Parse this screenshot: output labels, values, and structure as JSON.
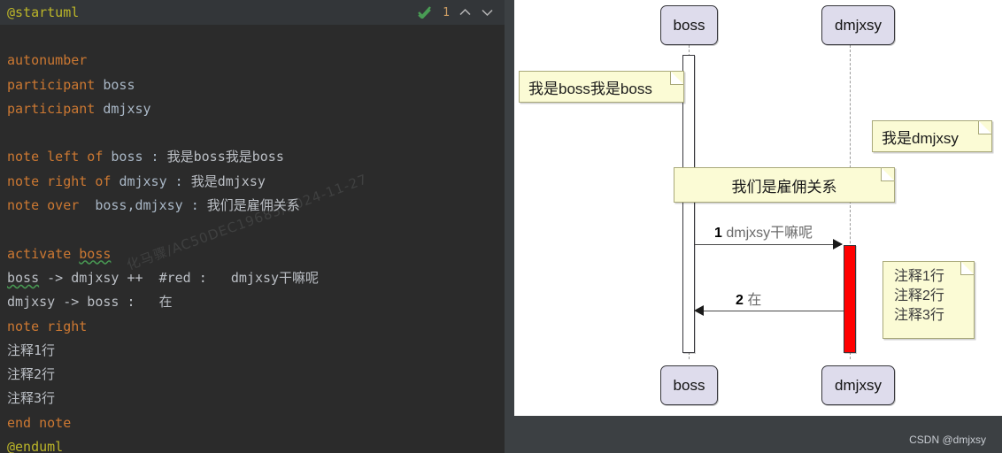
{
  "editor": {
    "first_line": "@startuml",
    "inspection_count": "1",
    "icons": {
      "check": "check-mark-icon",
      "up": "chevron-up-icon",
      "down": "chevron-down-icon"
    },
    "watermark": "化马骤/AC50DEC19685/2024-11-27",
    "lines": [
      {
        "indent": 0,
        "parts": []
      },
      {
        "parts": [
          {
            "t": "autonumber",
            "c": "kw"
          }
        ]
      },
      {
        "parts": [
          {
            "t": "participant ",
            "c": "kw"
          },
          {
            "t": "boss",
            "c": "id"
          }
        ]
      },
      {
        "parts": [
          {
            "t": "participant ",
            "c": "kw"
          },
          {
            "t": "dmjxsy",
            "c": "id"
          }
        ]
      },
      {
        "parts": []
      },
      {
        "parts": [
          {
            "t": "note left of ",
            "c": "kw"
          },
          {
            "t": "boss",
            "c": "id"
          },
          {
            "t": " : ",
            "c": "id"
          },
          {
            "t": "我是boss我是boss",
            "c": "plain"
          }
        ]
      },
      {
        "parts": [
          {
            "t": "note right of ",
            "c": "kw"
          },
          {
            "t": "dmjxsy",
            "c": "id"
          },
          {
            "t": " : ",
            "c": "id"
          },
          {
            "t": "我是dmjxsy",
            "c": "plain"
          }
        ]
      },
      {
        "parts": [
          {
            "t": "note over ",
            "c": "kw"
          },
          {
            "t": " boss,dmjxsy",
            "c": "id"
          },
          {
            "t": " : ",
            "c": "id"
          },
          {
            "t": "我们是雇佣关系",
            "c": "plain"
          }
        ]
      },
      {
        "parts": []
      },
      {
        "parts": [
          {
            "t": "activate ",
            "c": "kw"
          },
          {
            "t": "boss",
            "c": "kw err"
          }
        ]
      },
      {
        "parts": [
          {
            "t": "boss",
            "c": "plain err"
          },
          {
            "t": " -> dmjxsy ++  #red :   dmjxsy干嘛呢",
            "c": "plain"
          }
        ]
      },
      {
        "parts": [
          {
            "t": "dmjxsy -> boss :   在",
            "c": "plain"
          }
        ]
      },
      {
        "parts": [
          {
            "t": "note right",
            "c": "kw"
          }
        ]
      },
      {
        "parts": [
          {
            "t": "注释1行",
            "c": "plain"
          }
        ]
      },
      {
        "parts": [
          {
            "t": "注释2行",
            "c": "plain"
          }
        ]
      },
      {
        "parts": [
          {
            "t": "注释3行",
            "c": "plain"
          }
        ]
      },
      {
        "parts": [
          {
            "t": "end note",
            "c": "kw"
          }
        ]
      },
      {
        "parts": [
          {
            "t": "@enduml",
            "c": "anno"
          }
        ]
      }
    ]
  },
  "diagram": {
    "watermark": "CSDN @dmjxsy",
    "participants": [
      {
        "name": "boss",
        "pos": "top"
      },
      {
        "name": "dmjxsy",
        "pos": "top"
      },
      {
        "name": "boss",
        "pos": "bottom"
      },
      {
        "name": "dmjxsy",
        "pos": "bottom"
      }
    ],
    "notes": [
      {
        "id": "note-left-boss",
        "text": "我是boss我是boss"
      },
      {
        "id": "note-right-dmjxsy",
        "text": "我是dmjxsy"
      },
      {
        "id": "note-over-both",
        "text": "我们是雇佣关系"
      }
    ],
    "note_multiline": {
      "id": "note-right-dmjxsy-multiline",
      "lines": [
        "注释1行",
        "注释2行",
        "注释3行"
      ]
    },
    "messages": [
      {
        "number": "1",
        "text": "dmjxsy干嘛呢",
        "direction": "right"
      },
      {
        "number": "2",
        "text": "在",
        "direction": "left"
      }
    ],
    "colors": {
      "participant_fill": "#dedcec",
      "note_fill": "#fbfbd5",
      "activation_red": "#ff0000",
      "activation_white": "#ffffff",
      "canvas": "#ffffff"
    }
  }
}
